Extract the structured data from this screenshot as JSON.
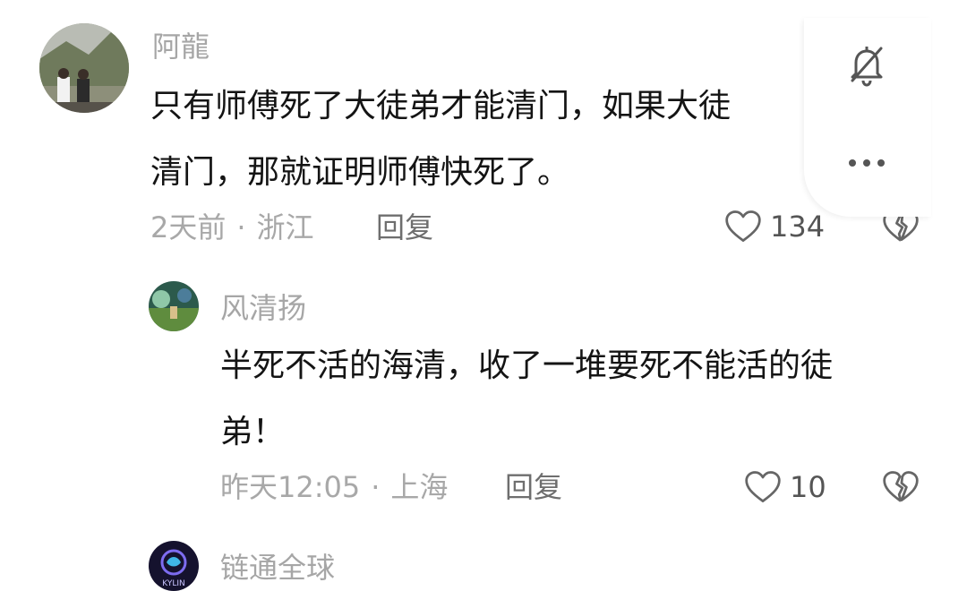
{
  "comments": [
    {
      "username": "阿龍",
      "text_lines": [
        "只有师傅死了大徒弟才能清门，如果大徒",
        "清门，那就证明师傅快死了。"
      ],
      "time": "2天前",
      "location": "浙江",
      "reply_label": "回复",
      "likes": "134",
      "avatar_icon": "photo-avatar-icon"
    },
    {
      "username": "风清扬",
      "text_lines": [
        "半死不活的海清，收了一堆要死不能活的徒",
        "弟！"
      ],
      "time": "昨天12:05",
      "location": "上海",
      "reply_label": "回复",
      "likes": "10",
      "avatar_icon": "game-avatar-icon"
    },
    {
      "username": "链通全球",
      "avatar_icon": "kylin-logo-avatar-icon",
      "avatar_text": "KYLIN"
    }
  ],
  "meta_separator": "·",
  "popover": {
    "icons": [
      "bell-off-icon",
      "more-icon"
    ]
  },
  "colors": {
    "meta_gray": "#a8a8a8",
    "text": "#141414",
    "icon_gray": "#666666"
  }
}
